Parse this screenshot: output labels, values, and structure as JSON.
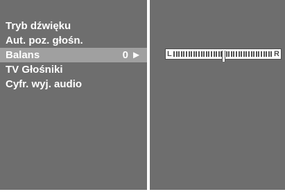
{
  "menu": {
    "items": [
      {
        "label": "Tryb dźwięku",
        "value": ""
      },
      {
        "label": "Aut. poz. głośn.",
        "value": ""
      },
      {
        "label": "Balans",
        "value": "0 ►",
        "selected": true
      },
      {
        "label": "TV Głośniki",
        "value": ""
      },
      {
        "label": "Cyfr. wyj. audio",
        "value": ""
      }
    ]
  },
  "balance": {
    "left_label": "L",
    "right_label": "R",
    "value": 0,
    "range": [
      -50,
      50
    ]
  },
  "colors": {
    "panel": "#6e6e6e",
    "highlight": "#a0a0a0",
    "text": "#ffffff"
  }
}
